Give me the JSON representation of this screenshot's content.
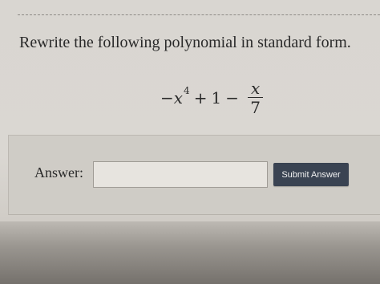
{
  "question": {
    "prompt": "Rewrite the following polynomial in standard form."
  },
  "expression": {
    "minus_1": "−",
    "variable_1": "x",
    "exponent": "4",
    "plus": "+",
    "constant": "1",
    "minus_2": "−",
    "numerator": "x",
    "denominator": "7"
  },
  "answer": {
    "label": "Answer:",
    "value": "",
    "submit_label": "Submit Answer"
  }
}
